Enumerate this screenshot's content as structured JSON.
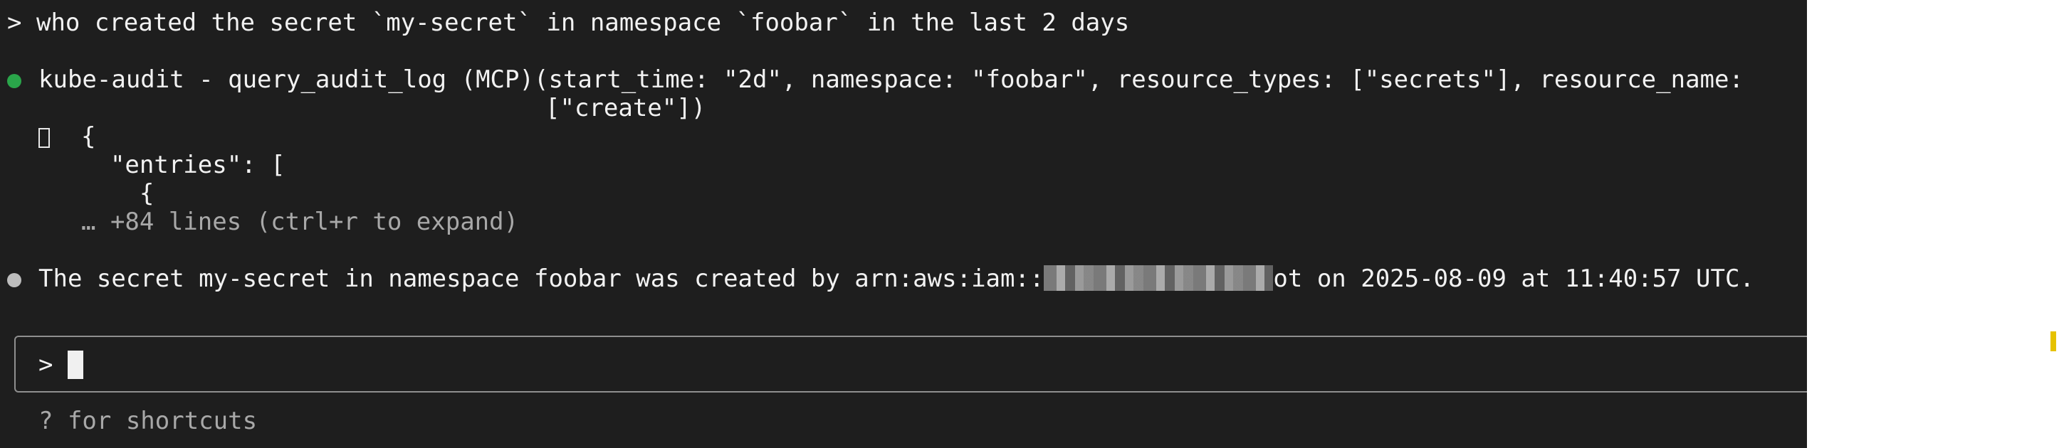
{
  "prompt": {
    "marker": ">",
    "text": "who created the secret `my-secret` in namespace `foobar` in the last 2 days"
  },
  "tool_call": {
    "line1": "kube-audit - query_audit_log (MCP)(start_time: \"2d\", namespace: \"foobar\", resource_types: [\"secrets\"], resource_name: ",
    "line2": "[\"create\"])",
    "status_color": "#2aa54a"
  },
  "output": {
    "lines": [
      "{",
      "  \"entries\": [",
      "    {"
    ],
    "collapsed_note": "… +84 lines (ctrl+r to expand)"
  },
  "answer": {
    "before_redaction": "The secret my-secret in namespace foobar was created by arn:aws:iam::",
    "after_redaction": "ot on 2025-08-09 at 11:40:57 UTC.",
    "bullet_color": "#bdbdbd"
  },
  "input": {
    "prompt": ">",
    "value": ""
  },
  "footer": {
    "hint": "? for shortcuts"
  },
  "colors": {
    "background": "#1e1e1e",
    "text": "#f2f2f2",
    "dim_text": "#a8a8a8",
    "edge_marker": "#e6c200"
  }
}
